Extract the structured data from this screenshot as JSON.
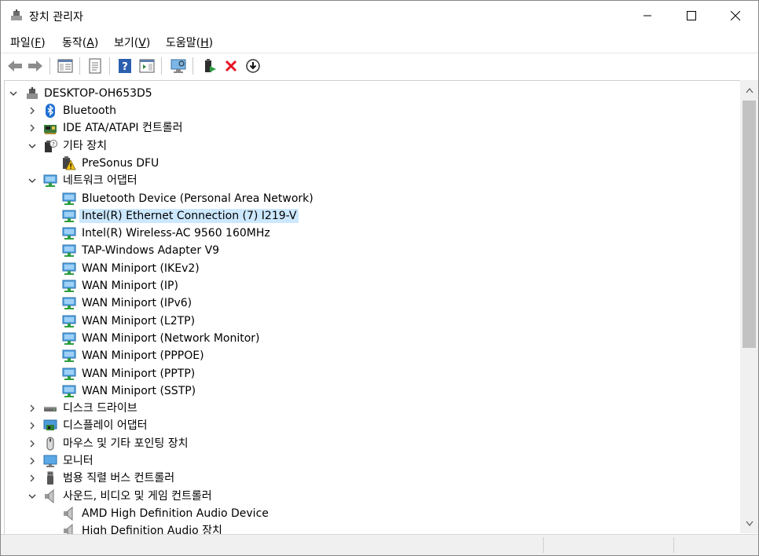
{
  "window": {
    "title": "장치 관리자"
  },
  "menu": [
    {
      "label": "파일(",
      "key": "F",
      "end": ")"
    },
    {
      "label": "동작(",
      "key": "A",
      "end": ")"
    },
    {
      "label": "보기(",
      "key": "V",
      "end": ")"
    },
    {
      "label": "도움말(",
      "key": "H",
      "end": ")"
    }
  ],
  "toolbar": [
    "back-icon",
    "forward-icon",
    "properties-pane-icon",
    "properties-icon",
    "help-icon",
    "action-pane-icon",
    "scan-hardware-icon",
    "update-driver-icon",
    "uninstall-icon",
    "disable-icon"
  ],
  "tree": {
    "root": "DESKTOP-OH653D5",
    "nodes": [
      {
        "label": "Bluetooth",
        "icon": "bluetooth-icon",
        "state": "collapsed",
        "level": 1
      },
      {
        "label": "IDE ATA/ATAPI 컨트롤러",
        "icon": "ide-controller-icon",
        "state": "collapsed",
        "level": 1
      },
      {
        "label": "기타 장치",
        "icon": "other-devices-icon",
        "state": "expanded",
        "level": 1
      },
      {
        "label": "PreSonus DFU",
        "icon": "warning-device-icon",
        "state": "leaf",
        "level": 2
      },
      {
        "label": "네트워크 어댑터",
        "icon": "network-adapter-icon",
        "state": "expanded",
        "level": 1
      },
      {
        "label": "Bluetooth Device (Personal Area Network)",
        "icon": "network-adapter-icon",
        "state": "leaf",
        "level": 2
      },
      {
        "label": "Intel(R) Ethernet Connection (7) I219-V",
        "icon": "network-adapter-icon",
        "state": "leaf",
        "level": 2,
        "selected": true
      },
      {
        "label": "Intel(R) Wireless-AC 9560 160MHz",
        "icon": "network-adapter-icon",
        "state": "leaf",
        "level": 2
      },
      {
        "label": "TAP-Windows Adapter V9",
        "icon": "network-adapter-icon",
        "state": "leaf",
        "level": 2
      },
      {
        "label": "WAN Miniport (IKEv2)",
        "icon": "network-adapter-icon",
        "state": "leaf",
        "level": 2
      },
      {
        "label": "WAN Miniport (IP)",
        "icon": "network-adapter-icon",
        "state": "leaf",
        "level": 2
      },
      {
        "label": "WAN Miniport (IPv6)",
        "icon": "network-adapter-icon",
        "state": "leaf",
        "level": 2
      },
      {
        "label": "WAN Miniport (L2TP)",
        "icon": "network-adapter-icon",
        "state": "leaf",
        "level": 2
      },
      {
        "label": "WAN Miniport (Network Monitor)",
        "icon": "network-adapter-icon",
        "state": "leaf",
        "level": 2
      },
      {
        "label": "WAN Miniport (PPPOE)",
        "icon": "network-adapter-icon",
        "state": "leaf",
        "level": 2
      },
      {
        "label": "WAN Miniport (PPTP)",
        "icon": "network-adapter-icon",
        "state": "leaf",
        "level": 2
      },
      {
        "label": "WAN Miniport (SSTP)",
        "icon": "network-adapter-icon",
        "state": "leaf",
        "level": 2
      },
      {
        "label": "디스크 드라이브",
        "icon": "disk-drive-icon",
        "state": "collapsed",
        "level": 1
      },
      {
        "label": "디스플레이 어댑터",
        "icon": "display-adapter-icon",
        "state": "collapsed",
        "level": 1
      },
      {
        "label": "마우스 및 기타 포인팅 장치",
        "icon": "mouse-icon",
        "state": "collapsed",
        "level": 1
      },
      {
        "label": "모니터",
        "icon": "monitor-icon",
        "state": "collapsed",
        "level": 1
      },
      {
        "label": "범용 직렬 버스 컨트롤러",
        "icon": "usb-icon",
        "state": "collapsed",
        "level": 1
      },
      {
        "label": "사운드, 비디오 및 게임 컨트롤러",
        "icon": "speaker-icon",
        "state": "expanded",
        "level": 1
      },
      {
        "label": "AMD High Definition Audio Device",
        "icon": "speaker-icon",
        "state": "leaf",
        "level": 2
      },
      {
        "label": "High Definition Audio 장치",
        "icon": "speaker-icon",
        "state": "leaf",
        "level": 2
      }
    ]
  },
  "colors": {
    "selection": "#cce8ff",
    "accent": "#2a7fd4",
    "error": "#e81123"
  }
}
